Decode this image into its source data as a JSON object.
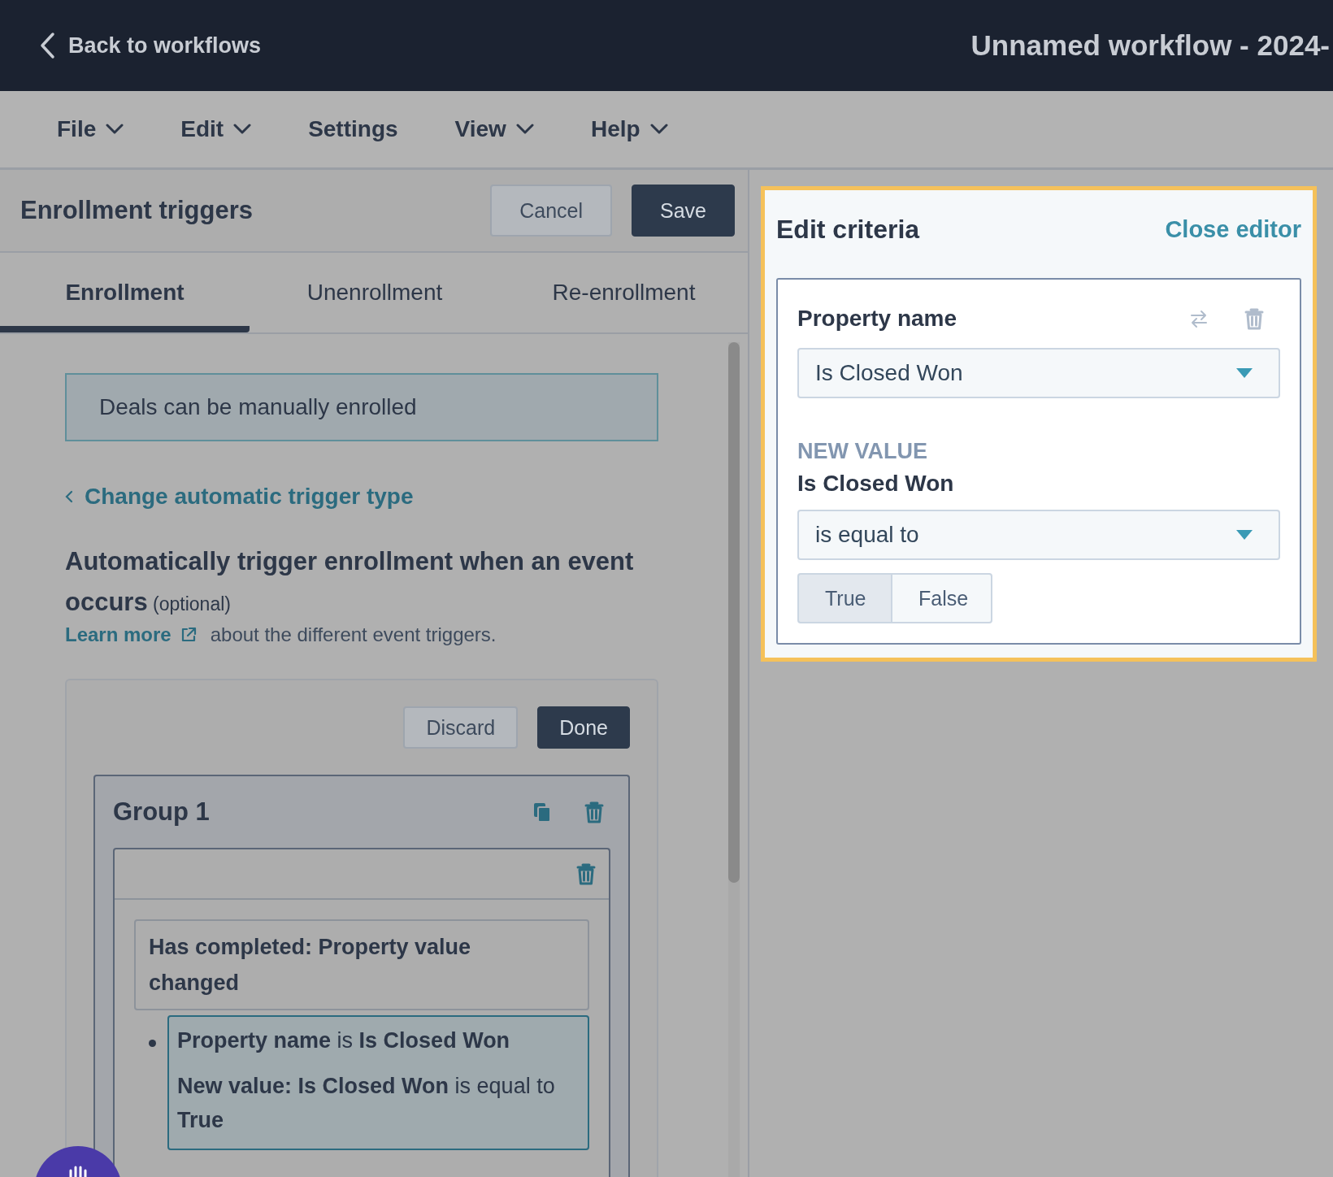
{
  "top_bar": {
    "back_link": "Back to workflows",
    "title": "Unnamed workflow - 2024-"
  },
  "menu": [
    {
      "label": "File",
      "dropdown": true
    },
    {
      "label": "Edit",
      "dropdown": true
    },
    {
      "label": "Settings",
      "dropdown": false
    },
    {
      "label": "View",
      "dropdown": true
    },
    {
      "label": "Help",
      "dropdown": true
    }
  ],
  "enrollment_panel": {
    "title": "Enrollment triggers",
    "buttons": [
      {
        "label": "Cancel",
        "kind": "secondary"
      },
      {
        "label": "Save",
        "kind": "primary"
      }
    ],
    "tabs": [
      {
        "label": "Enrollment",
        "selected": true
      },
      {
        "label": "Unenrollment",
        "selected": false
      },
      {
        "label": "Re-enrollment",
        "selected": false
      }
    ],
    "notice": "Deals can be manually enrolled",
    "change_link": "Change automatic trigger type",
    "heading": "**Automatically trigger enrollment when an event occurs** (optional)",
    "learn_more": {
      "link": "Learn more",
      "text": "about the different event triggers."
    },
    "editor": {
      "buttons": [
        {
          "label": "Discard",
          "kind": "secondary"
        },
        {
          "label": "Done",
          "kind": "primary"
        }
      ],
      "group": {
        "title": "Group 1",
        "filters": [
          {
            "event": "Has completed: Property value changed",
            "criteria": [
              {
                "highlighted": true,
                "lines": [
                  "**Property name** is **Is Closed Won**",
                  "**New value: Is Closed Won** is equal to **True**"
                ]
              }
            ]
          }
        ]
      }
    }
  },
  "criteria_editor": {
    "title": "Edit criteria",
    "close": "Close editor",
    "property_label": "Property name",
    "property_value": "Is Closed Won",
    "section_label": "NEW VALUE",
    "value_label": "Is Closed Won",
    "operator": "is equal to",
    "options": [
      {
        "label": "True",
        "selected": true
      },
      {
        "label": "False",
        "selected": false
      }
    ]
  }
}
